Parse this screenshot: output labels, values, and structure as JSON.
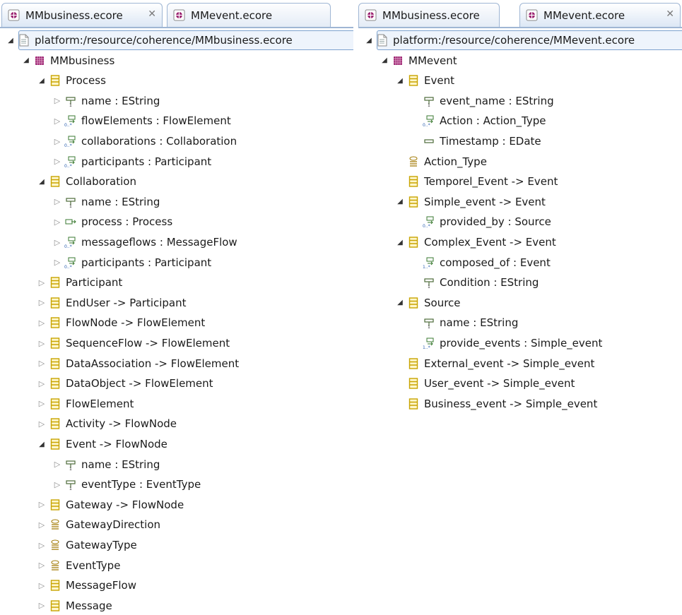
{
  "left": {
    "tabs": [
      {
        "label": "MMbusiness.ecore",
        "icon": "ecore-file-icon",
        "close": "✕",
        "active": true
      },
      {
        "label": "MMevent.ecore",
        "icon": "ecore-file-icon",
        "active": false
      }
    ],
    "tree": [
      {
        "label": "platform:/resource/coherence/MMbusiness.ecore",
        "icon": "resource-file-icon",
        "level": 0,
        "twisty": "open",
        "selected": true
      },
      {
        "label": "MMbusiness",
        "icon": "package-icon",
        "level": 1,
        "twisty": "open"
      },
      {
        "label": "Process",
        "icon": "class-icon",
        "level": 2,
        "twisty": "open"
      },
      {
        "label": "name : EString",
        "icon": "attribute-icon",
        "level": 3,
        "twisty": "closed"
      },
      {
        "label": "flowElements : FlowElement",
        "icon": "reference-many-icon",
        "level": 3,
        "twisty": "closed"
      },
      {
        "label": "collaborations : Collaboration",
        "icon": "reference-many-icon",
        "level": 3,
        "twisty": "closed"
      },
      {
        "label": "participants : Participant",
        "icon": "reference-many-icon",
        "level": 3,
        "twisty": "closed"
      },
      {
        "label": "Collaboration",
        "icon": "class-icon",
        "level": 2,
        "twisty": "open"
      },
      {
        "label": "name : EString",
        "icon": "attribute-icon",
        "level": 3,
        "twisty": "closed"
      },
      {
        "label": "process : Process",
        "icon": "reference-single-icon",
        "level": 3,
        "twisty": "closed"
      },
      {
        "label": "messageflows : MessageFlow",
        "icon": "reference-many-icon",
        "level": 3,
        "twisty": "closed"
      },
      {
        "label": "participants : Participant",
        "icon": "reference-many-icon",
        "level": 3,
        "twisty": "closed"
      },
      {
        "label": "Participant",
        "icon": "class-icon",
        "level": 2,
        "twisty": "closed"
      },
      {
        "label": "EndUser -> Participant",
        "icon": "class-icon",
        "level": 2,
        "twisty": "closed"
      },
      {
        "label": "FlowNode -> FlowElement",
        "icon": "class-icon",
        "level": 2,
        "twisty": "closed"
      },
      {
        "label": "SequenceFlow -> FlowElement",
        "icon": "class-icon",
        "level": 2,
        "twisty": "closed"
      },
      {
        "label": "DataAssociation -> FlowElement",
        "icon": "class-icon",
        "level": 2,
        "twisty": "closed"
      },
      {
        "label": "DataObject -> FlowElement",
        "icon": "class-icon",
        "level": 2,
        "twisty": "closed"
      },
      {
        "label": "FlowElement",
        "icon": "class-icon",
        "level": 2,
        "twisty": "closed"
      },
      {
        "label": "Activity -> FlowNode",
        "icon": "class-icon",
        "level": 2,
        "twisty": "closed"
      },
      {
        "label": "Event -> FlowNode",
        "icon": "class-icon",
        "level": 2,
        "twisty": "open"
      },
      {
        "label": "name : EString",
        "icon": "attribute-icon",
        "level": 3,
        "twisty": "closed"
      },
      {
        "label": "eventType : EventType",
        "icon": "attribute-icon",
        "level": 3,
        "twisty": "closed"
      },
      {
        "label": "Gateway -> FlowNode",
        "icon": "class-icon",
        "level": 2,
        "twisty": "closed"
      },
      {
        "label": "GatewayDirection",
        "icon": "enum-icon",
        "level": 2,
        "twisty": "closed"
      },
      {
        "label": "GatewayType",
        "icon": "enum-icon",
        "level": 2,
        "twisty": "closed"
      },
      {
        "label": "EventType",
        "icon": "enum-icon",
        "level": 2,
        "twisty": "closed"
      },
      {
        "label": "MessageFlow",
        "icon": "class-icon",
        "level": 2,
        "twisty": "closed"
      },
      {
        "label": "Message",
        "icon": "class-icon",
        "level": 2,
        "twisty": "closed"
      }
    ]
  },
  "right": {
    "tabs": [
      {
        "label": "MMbusiness.ecore",
        "icon": "ecore-file-icon",
        "active": false
      },
      {
        "label": "MMevent.ecore",
        "icon": "ecore-file-icon",
        "close": "✕",
        "active": true
      }
    ],
    "tree": [
      {
        "label": "platform:/resource/coherence/MMevent.ecore",
        "icon": "resource-file-icon",
        "level": 0,
        "twisty": "open",
        "selected": true
      },
      {
        "label": "MMevent",
        "icon": "package-icon",
        "level": 1,
        "twisty": "open"
      },
      {
        "label": "Event",
        "icon": "class-icon",
        "level": 2,
        "twisty": "open"
      },
      {
        "label": "event_name : EString",
        "icon": "attribute-icon",
        "level": 3,
        "twisty": "none"
      },
      {
        "label": "Action : Action_Type",
        "icon": "reference-many-icon",
        "level": 3,
        "twisty": "none"
      },
      {
        "label": "Timestamp : EDate",
        "icon": "datatype-attribute-icon",
        "level": 3,
        "twisty": "none"
      },
      {
        "label": "Action_Type",
        "icon": "enum-icon",
        "level": 2,
        "twisty": "none"
      },
      {
        "label": "Temporel_Event -> Event",
        "icon": "class-icon",
        "level": 2,
        "twisty": "none"
      },
      {
        "label": "Simple_event -> Event",
        "icon": "class-icon",
        "level": 2,
        "twisty": "open"
      },
      {
        "label": "provided_by : Source",
        "icon": "reference-many-icon",
        "level": 3,
        "twisty": "none"
      },
      {
        "label": "Complex_Event -> Event",
        "icon": "class-icon",
        "level": 2,
        "twisty": "open"
      },
      {
        "label": "composed_of : Event",
        "icon": "reference-one-many-icon",
        "level": 3,
        "twisty": "none"
      },
      {
        "label": "Condition : EString",
        "icon": "attribute-icon",
        "level": 3,
        "twisty": "none"
      },
      {
        "label": "Source",
        "icon": "class-icon",
        "level": 2,
        "twisty": "open"
      },
      {
        "label": "name : EString",
        "icon": "attribute-icon",
        "level": 3,
        "twisty": "none"
      },
      {
        "label": "provide_events : Simple_event",
        "icon": "reference-one-many-icon",
        "level": 3,
        "twisty": "none"
      },
      {
        "label": "External_event -> Simple_event",
        "icon": "class-icon",
        "level": 2,
        "twisty": "none"
      },
      {
        "label": "User_event -> Simple_event",
        "icon": "class-icon",
        "level": 2,
        "twisty": "none"
      },
      {
        "label": "Business_event -> Simple_event",
        "icon": "class-icon",
        "level": 2,
        "twisty": "none"
      }
    ]
  },
  "colors": {
    "class": "#c8a400",
    "package": "#9a1f6e",
    "reference": "#3a7a30",
    "attribute": "#555555",
    "tab_border": "#9fb6d4",
    "selection": "#7da2ce"
  }
}
